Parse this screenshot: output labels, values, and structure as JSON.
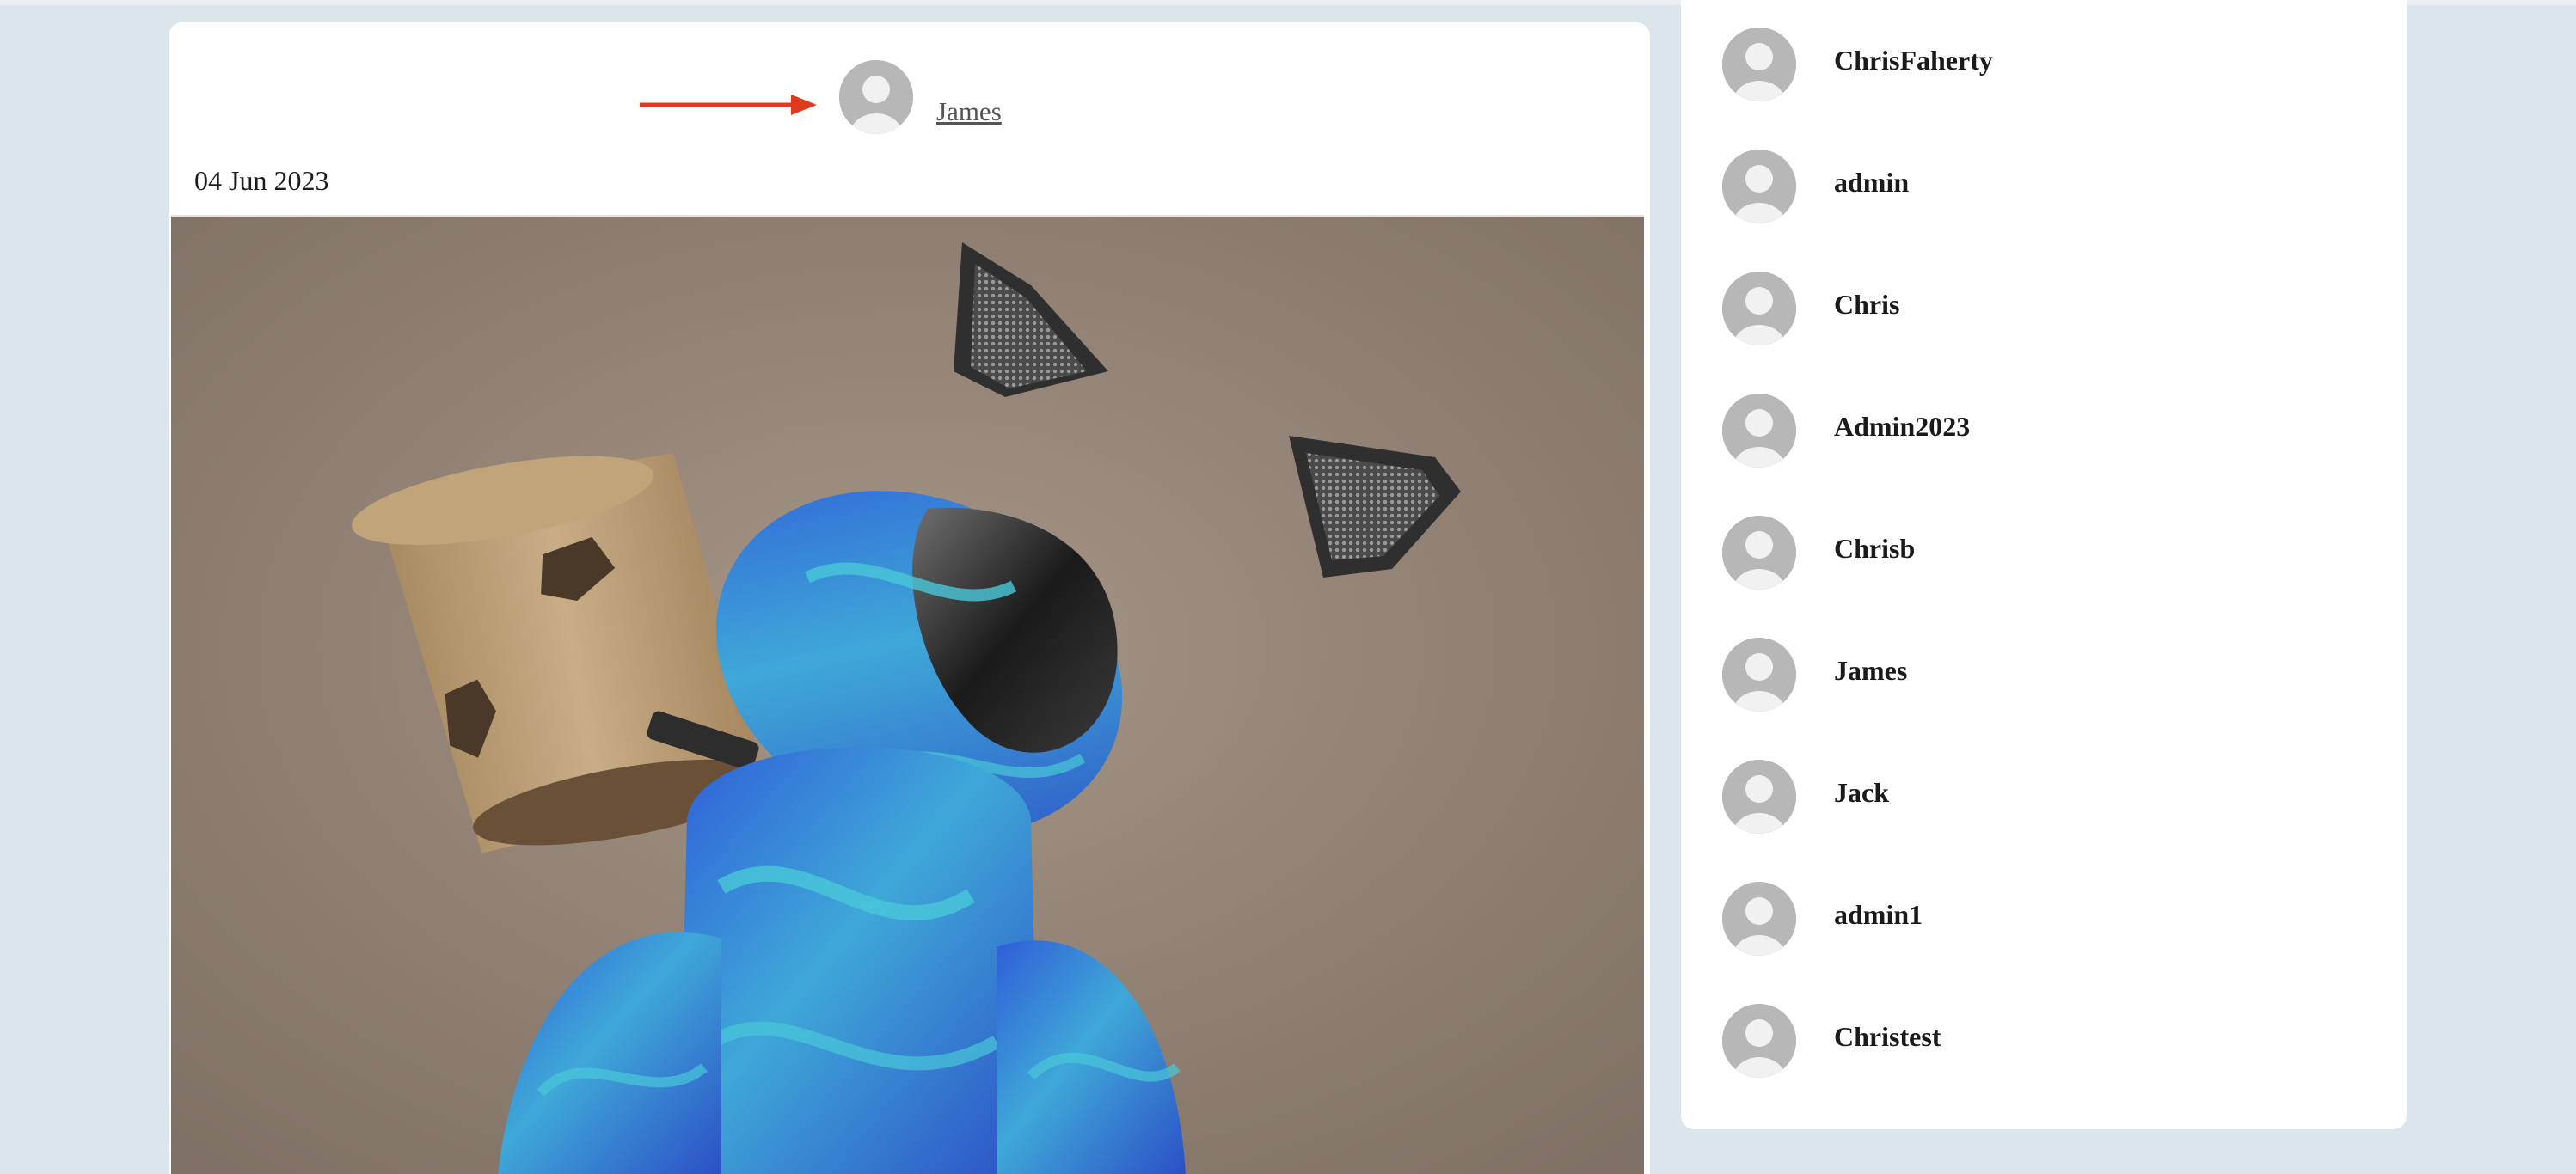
{
  "post": {
    "author": "James",
    "date": "04 Jun 2023",
    "annotation": {
      "arrow_color": "#e03a1e"
    },
    "image": {
      "background": "#8a7a6e",
      "colors": {
        "cardboard": "#b89c74",
        "blue": "#2e63d6",
        "cyan": "#44c7d6"
      }
    }
  },
  "sidebar": {
    "users": [
      {
        "name": "ChrisFaherty"
      },
      {
        "name": "admin"
      },
      {
        "name": "Chris"
      },
      {
        "name": "Admin2023"
      },
      {
        "name": "Chrisb"
      },
      {
        "name": "James"
      },
      {
        "name": "Jack"
      },
      {
        "name": "admin1"
      },
      {
        "name": "Christest"
      }
    ]
  },
  "icons": {
    "avatar": "default-user-icon"
  }
}
